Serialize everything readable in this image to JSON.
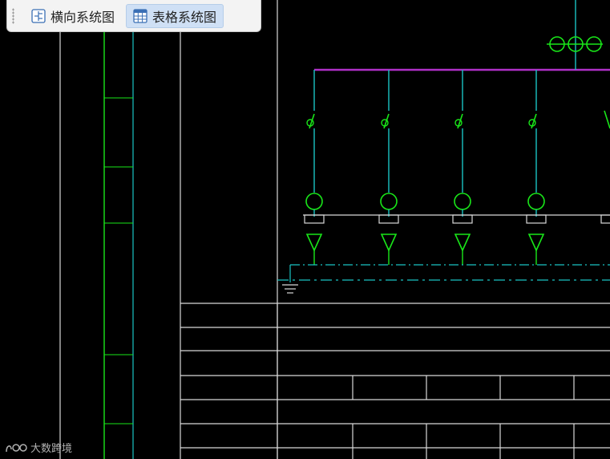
{
  "toolbar": {
    "buttons": [
      {
        "label": "横向系统图",
        "icon": "horizontal-diagram-icon",
        "active": false
      },
      {
        "label": "表格系统图",
        "icon": "table-diagram-icon",
        "active": true
      }
    ]
  },
  "watermark": {
    "text": "大数跨境"
  },
  "colors": {
    "background": "#000000",
    "green": "#19e619",
    "cyan": "#19c4c4",
    "white": "#d8d8d8",
    "magenta": "#b030c8",
    "toolbar_bg": "#f3f3f3",
    "active_bg": "#cfe0f5"
  },
  "drawing": {
    "feeder_count": 4,
    "table_rows": 8,
    "labels": []
  }
}
